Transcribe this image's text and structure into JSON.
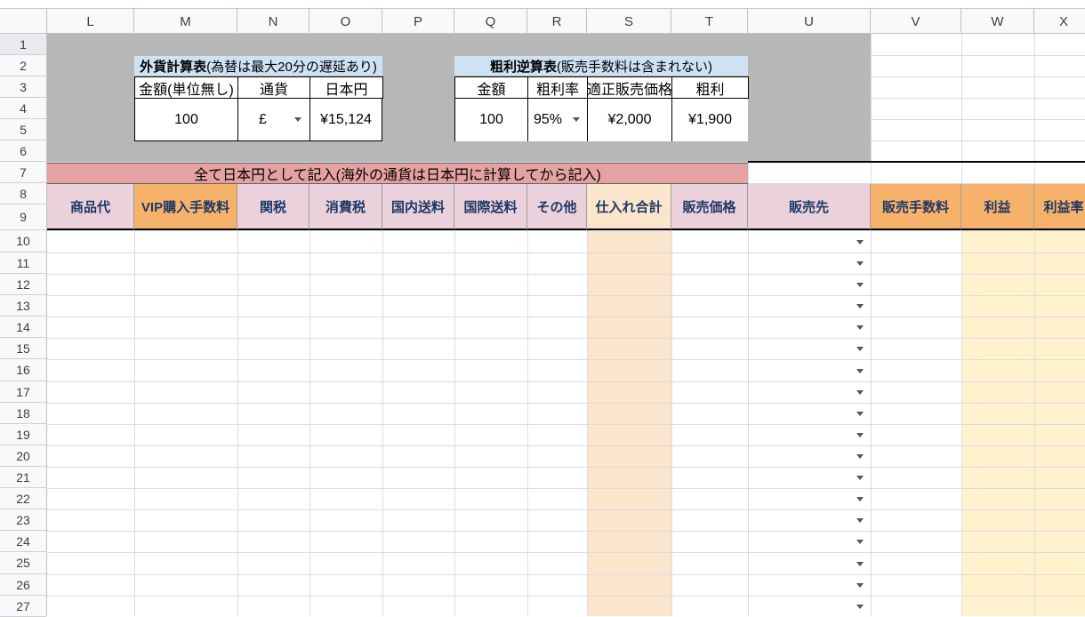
{
  "columns": [
    "L",
    "M",
    "N",
    "O",
    "P",
    "Q",
    "R",
    "S",
    "T",
    "U",
    "V",
    "W",
    "X"
  ],
  "rows": [
    "1",
    "2",
    "3",
    "4",
    "5",
    "6",
    "7",
    "8",
    "9",
    "10",
    "11",
    "12",
    "13",
    "14",
    "15",
    "16",
    "17",
    "18",
    "19",
    "20",
    "21",
    "22",
    "23",
    "24",
    "25",
    "26",
    "27"
  ],
  "fx_table": {
    "title_bold": "外貨計算表",
    "title_rest": "(為替は最大20分の遅延あり)",
    "headers": [
      "金額(単位無し)",
      "通貨",
      "日本円"
    ],
    "amount": "100",
    "currency": "£",
    "yen": "¥15,124"
  },
  "margin_table": {
    "title_bold": "粗利逆算表",
    "title_rest": "(販売手数料は含まれない)",
    "headers": [
      "金額",
      "粗利率",
      "適正販売価格",
      "粗利"
    ],
    "amount": "100",
    "rate": "95%",
    "price": "¥2,000",
    "profit": "¥1,900"
  },
  "notice": "全て日本円として記入(海外の通貨は日本円に計算してから記入)",
  "headers": [
    "商品代",
    "VIP購入手数料",
    "関税",
    "消費税",
    "国内送料",
    "国際送料",
    "その他",
    "仕入れ合計",
    "販売価格",
    "販売先",
    "販売手数料",
    "利益",
    "利益率"
  ],
  "colors": {
    "gray_panel": "#b7b7b7",
    "title_bar": "#cfe2f3",
    "notice_bar": "#e6a2a2",
    "pink_header": "#ead1dc",
    "orange_header": "#f6b26b",
    "light_orange": "#fce5cd",
    "light_yellow": "#fff2cc"
  }
}
